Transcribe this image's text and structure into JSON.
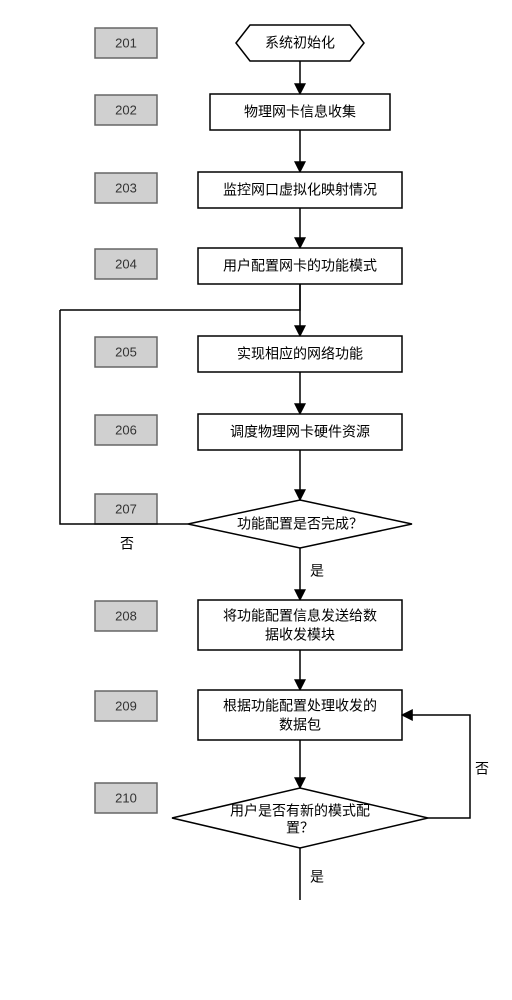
{
  "tags": {
    "t201": "201",
    "t202": "202",
    "t203": "203",
    "t204": "204",
    "t205": "205",
    "t206": "206",
    "t207": "207",
    "t208": "208",
    "t209": "209",
    "t210": "210"
  },
  "nodes": {
    "n1": "系统初始化",
    "n2": "物理网卡信息收集",
    "n3": "监控网口虚拟化映射情况",
    "n4": "用户配置网卡的功能模式",
    "n5": "实现相应的网络功能",
    "n6": "调度物理网卡硬件资源",
    "n7": "功能配置是否完成？",
    "n8a": "将功能配置信息发送给数",
    "n8b": "据收发模块",
    "n9a": "根据功能配置处理收发的",
    "n9b": "数据包",
    "n10a": "用户是否有新的模式配",
    "n10b": "置？"
  },
  "labels": {
    "yes": "是",
    "no": "否"
  }
}
